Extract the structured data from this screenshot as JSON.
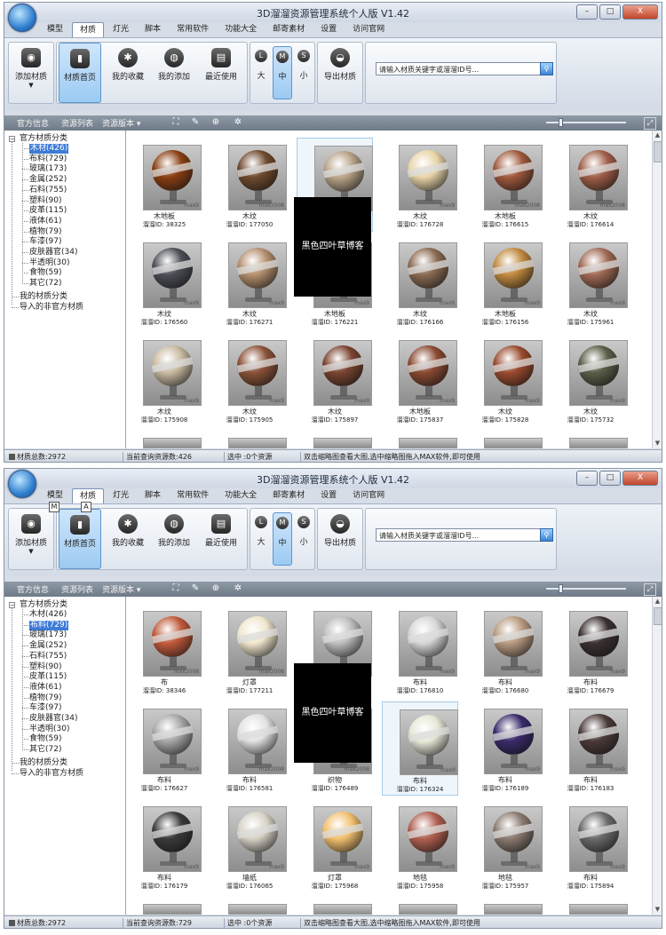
{
  "app": {
    "title": "3D溜溜资源管理系统个人版 V1.42",
    "window_buttons": {
      "minimize": "–",
      "maximize": "□",
      "close": "X"
    }
  },
  "tabs": [
    "模型",
    "材质",
    "灯光",
    "脚本",
    "常用软件",
    "功能大全",
    "邮寄素材",
    "设置",
    "访问官网"
  ],
  "ribbon": {
    "add": "添加材质",
    "home": "材质首页",
    "favorites": "我的收藏",
    "mine": "我的添加",
    "recent": "最近使用",
    "large": "大",
    "medium": "中",
    "small": "小",
    "export": "导出材质",
    "search_placeholder": "请输入材质关键字或溜溜ID号..."
  },
  "toolbar": {
    "info": "官方信息",
    "list": "资源列表",
    "version": "资源版本"
  },
  "icons": {
    "add": "rss-icon",
    "home": "book-icon",
    "favorites": "bluetooth-icon",
    "mine": "globe-icon",
    "recent": "chip-icon",
    "export": "dome-icon",
    "search": "search-icon",
    "fit": "fit-view-icon",
    "pen": "pen-icon",
    "zoom": "zoom-icon",
    "light": "sun-icon"
  },
  "tree": {
    "root": "官方材质分类",
    "mine": "我的材质分类",
    "imported": "导入的非官方材质",
    "categories": [
      "木材(426)",
      "布料(729)",
      "玻璃(173)",
      "金属(252)",
      "石料(755)",
      "塑料(90)",
      "皮革(115)",
      "液体(61)",
      "植物(79)",
      "车漆(97)",
      "皮肤器官(34)",
      "半透明(30)",
      "食物(59)",
      "其它(72)"
    ]
  },
  "overlay_text": "黑色四叶草博客",
  "windows": [
    {
      "selected_category": 0,
      "status": {
        "total": "材质总数:2972",
        "query": "当前查询资源数:426",
        "selected": "选中 :0个资源",
        "hint": "双击缩略图查看大图,选中缩略图拖入MAX软件,即可使用"
      },
      "items": [
        {
          "name": "木地板",
          "id": "溜溜ID: 38325",
          "badge": "max9",
          "color": "#8a3f12"
        },
        {
          "name": "木纹",
          "id": "溜溜ID: 177050",
          "badge": "max2008",
          "color": "#6f4a2e"
        },
        {
          "name": "",
          "id": "",
          "badge": "max9",
          "color": "#b7a287"
        },
        {
          "name": "木纹",
          "id": "溜溜ID: 176728",
          "badge": "max9",
          "color": "#e8d4a8"
        },
        {
          "name": "木地板",
          "id": "溜溜ID: 176615",
          "badge": "max2008",
          "color": "#a0593c"
        },
        {
          "name": "木纹",
          "id": "溜溜ID: 176614",
          "badge": "max2008",
          "color": "#a05e48"
        },
        {
          "name": "木纹",
          "id": "溜溜ID: 176560",
          "badge": "max9",
          "color": "#4b4e55"
        },
        {
          "name": "木纹",
          "id": "溜溜ID: 176271",
          "badge": "max9",
          "color": "#b48f6e"
        },
        {
          "name": "木地板",
          "id": "溜溜ID: 176221",
          "badge": "max9",
          "color": "#6d4a33"
        },
        {
          "name": "木纹",
          "id": "溜溜ID: 176166",
          "badge": "max9",
          "color": "#8a6a52"
        },
        {
          "name": "木地板",
          "id": "溜溜ID: 176156",
          "badge": "max9",
          "color": "#c08a3e"
        },
        {
          "name": "木纹",
          "id": "溜溜ID: 175961",
          "badge": "max9",
          "color": "#a06a55"
        },
        {
          "name": "木纹",
          "id": "溜溜ID: 175908",
          "badge": "max9",
          "color": "#cabba2"
        },
        {
          "name": "木纹",
          "id": "溜溜ID: 175905",
          "badge": "max9",
          "color": "#8a5238"
        },
        {
          "name": "木纹",
          "id": "溜溜ID: 175897",
          "badge": "max9",
          "color": "#7a4330"
        },
        {
          "name": "木地板",
          "id": "溜溜ID: 175837",
          "badge": "max9",
          "color": "#8a4a32"
        },
        {
          "name": "木纹",
          "id": "溜溜ID: 175828",
          "badge": "max9",
          "color": "#9a4a2e"
        },
        {
          "name": "木纹",
          "id": "溜溜ID: 175732",
          "badge": "max9",
          "color": "#5a5e48"
        }
      ]
    },
    {
      "selected_category": 1,
      "status": {
        "total": "材质总数:2972",
        "query": "当前查询资源数:729",
        "selected": "选中 :0个资源",
        "hint": "双击缩略图查看大图,选中缩略图拖入MAX软件,即可使用"
      },
      "items": [
        {
          "name": "布",
          "id": "溜溜ID: 38346",
          "badge": "max2008",
          "color": "#c0593a"
        },
        {
          "name": "灯罩",
          "id": "溜溜ID: 177211",
          "badge": "max2008",
          "color": "#efe6cc"
        },
        {
          "name": "",
          "id": "",
          "badge": "max9",
          "color": "#bdbdbd"
        },
        {
          "name": "布料",
          "id": "溜溜ID: 176810",
          "badge": "max9",
          "color": "#d6d6d6"
        },
        {
          "name": "布料",
          "id": "溜溜ID: 176680",
          "badge": "max9",
          "color": "#b89a80"
        },
        {
          "name": "布料",
          "id": "溜溜ID: 176679",
          "badge": "max9",
          "color": "#3b3030"
        },
        {
          "name": "布料",
          "id": "溜溜ID: 176627",
          "badge": "max9",
          "color": "#a8a8a8"
        },
        {
          "name": "布料",
          "id": "溜溜ID: 176581",
          "badge": "max2008",
          "color": "#e2e2e2"
        },
        {
          "name": "织物",
          "id": "溜溜ID: 176489",
          "badge": "max2008",
          "color": "#9a9a9a"
        },
        {
          "name": "布料",
          "id": "溜溜ID: 176324",
          "badge": "max9",
          "color": "#e6e6d6"
        },
        {
          "name": "布料",
          "id": "溜溜ID: 176189",
          "badge": "max9",
          "color": "#3a2a6a"
        },
        {
          "name": "布料",
          "id": "溜溜ID: 176183",
          "badge": "max9",
          "color": "#4a3a38"
        },
        {
          "name": "布料",
          "id": "溜溜ID: 176179",
          "badge": "max9",
          "color": "#3a3a3a"
        },
        {
          "name": "墙纸",
          "id": "溜溜ID: 176065",
          "badge": "max9",
          "color": "#d8d2c6"
        },
        {
          "name": "灯罩",
          "id": "溜溜ID: 175968",
          "badge": "max9",
          "color": "#f2c070"
        },
        {
          "name": "地毯",
          "id": "溜溜ID: 175958",
          "badge": "max9",
          "color": "#b06050"
        },
        {
          "name": "地毯",
          "id": "溜溜ID: 175957",
          "badge": "max9",
          "color": "#8a7a70"
        },
        {
          "name": "布料",
          "id": "溜溜ID: 175894",
          "badge": "max9",
          "color": "#6a6a6a"
        }
      ]
    }
  ]
}
